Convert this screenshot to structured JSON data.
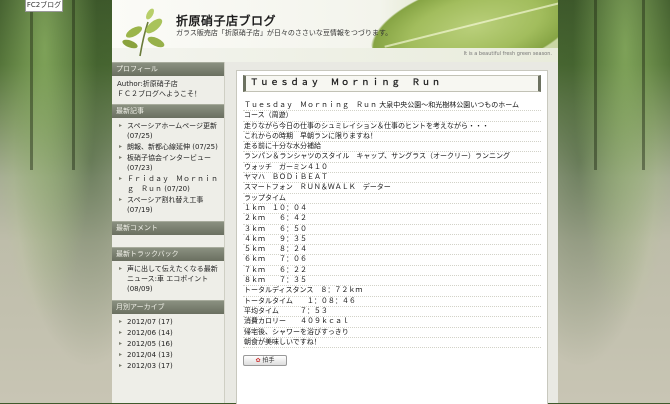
{
  "fc2_badge": "FC2ブログ",
  "header": {
    "title": "折原硝子店ブログ",
    "description": "ガラス販売店「折原硝子店」が日々のささいな豆情報をつづります。",
    "tagline": "It is a beautiful fresh green season."
  },
  "sidebar": {
    "profile": {
      "heading": "プロフィール",
      "author": "Author:折原硝子店",
      "greeting": "ＦＣ２ブログへようこそ！"
    },
    "recent_posts": {
      "heading": "最新記事",
      "items": [
        {
          "title": "スペーシアホームページ更新",
          "date": "(07/25)"
        },
        {
          "title": "朗報、新都心線延伸",
          "date": "(07/25)"
        },
        {
          "title": "板硝子協会インタービュー",
          "date": "(07/23)"
        },
        {
          "title": "Ｆｒｉｄａｙ　Ｍｏｒｎｉｎｇ　Ｒｕｎ",
          "date": "(07/20)"
        },
        {
          "title": "スペーシア割れ替え工事",
          "date": "(07/19)"
        }
      ]
    },
    "recent_comments": {
      "heading": "最新コメント"
    },
    "recent_trackbacks": {
      "heading": "最新トラックバック",
      "items": [
        {
          "title": "声に出して伝えたくなる最新ニュース:車 エコポイント",
          "date": "(08/09)"
        }
      ]
    },
    "archives": {
      "heading": "月別アーカイブ",
      "items": [
        "2012/07 (17)",
        "2012/06 (14)",
        "2012/05 (16)",
        "2012/04 (13)",
        "2012/03 (17)"
      ]
    }
  },
  "article": {
    "title": "Ｔｕｅｓｄａｙ　Ｍｏｒｎｉｎｇ　Ｒｕｎ",
    "lines": [
      "Ｔｕｅｓｄａｙ　Ｍｏｒｎｉｎｇ　Ｒｕｎ 大泉中央公園〜和光樹林公園いつものホーム",
      "コース（周遊）",
      "走りながら今日の仕事のシュミレイション＆仕事のヒントを考えながら・・・",
      "これからの時期　早朝ランに限りますね！",
      "走る前に十分な水分補給",
      "ランパン＆ランシャツのスタイル　キャップ、サングラス（オークリー）ランニング",
      "ウォッチ　ガーミン４１０",
      "ヤマハ　ＢＯＤｉＢＥＡＴ",
      "スマートフォン　ＲＵＮ＆ＷＡＬＫ　データー",
      "ラップタイム",
      "１ｋｍ　１０：０４",
      "２ｋｍ　　６：４２",
      "３ｋｍ　　６：５０",
      "４ｋｍ　　９：３５",
      "５ｋｍ　　８：２４",
      "６ｋｍ　　７：０６",
      "７ｋｍ　　６：２２",
      "８ｋｍ　　７：３５",
      "トータルディスタンス　８：７２ｋｍ",
      "トータルタイム　　１：０８：４６",
      "平均タイム　　　７：５３",
      "消費カロリー　　４０９ｋｃａｌ",
      "帰宅後、シャワーを浴びすっきり",
      "朝食が美味しいですね！"
    ],
    "clap_label": "拍手"
  }
}
